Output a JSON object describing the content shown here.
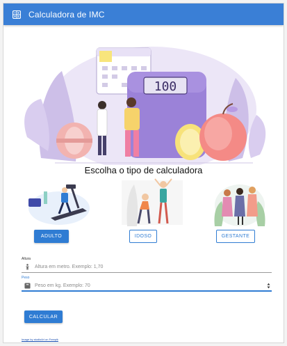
{
  "app": {
    "title": "Calculadora de IMC",
    "accent": "#3a7fd6",
    "icon": "calculator-icon"
  },
  "main": {
    "heading": "Escolha o tipo de calculadora",
    "categories": [
      {
        "label": "ADULTO",
        "active": true,
        "illustration": "treadmill-illustration"
      },
      {
        "label": "IDOSO",
        "active": false,
        "illustration": "elderly-exercise-illustration"
      },
      {
        "label": "GESTANTE",
        "active": false,
        "illustration": "pregnant-women-illustration"
      }
    ],
    "scale_display": "100"
  },
  "form": {
    "height": {
      "label": "Altura",
      "placeholder": "Altura em metro. Exemplo: 1,70",
      "icon": "person-height-icon"
    },
    "weight": {
      "label": "Peso",
      "placeholder": "Peso em kg. Exemplo: 70",
      "icon": "scale-icon"
    },
    "submit_label": "CALCULAR"
  },
  "footer": {
    "credit": "Image by studio4rt on Freepik"
  }
}
